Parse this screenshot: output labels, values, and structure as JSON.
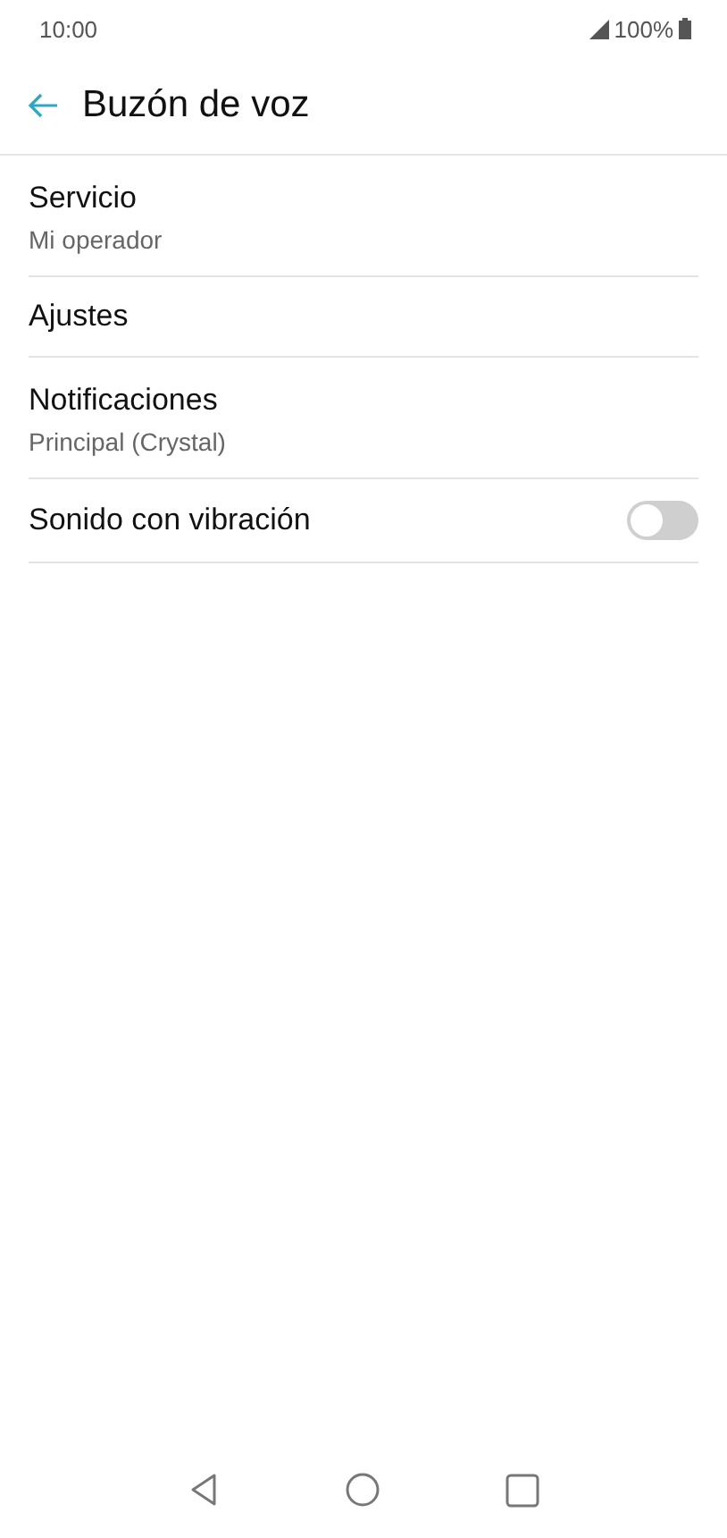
{
  "status_bar": {
    "time": "10:00",
    "battery": "100%"
  },
  "header": {
    "title": "Buzón de voz"
  },
  "items": [
    {
      "kind": "text",
      "title": "Servicio",
      "subtitle": "Mi operador"
    },
    {
      "kind": "text",
      "title": "Ajustes"
    },
    {
      "kind": "text",
      "title": "Notificaciones",
      "subtitle": "Principal (Crystal)"
    },
    {
      "kind": "switch",
      "title": "Sonido con vibración",
      "on": false
    }
  ]
}
